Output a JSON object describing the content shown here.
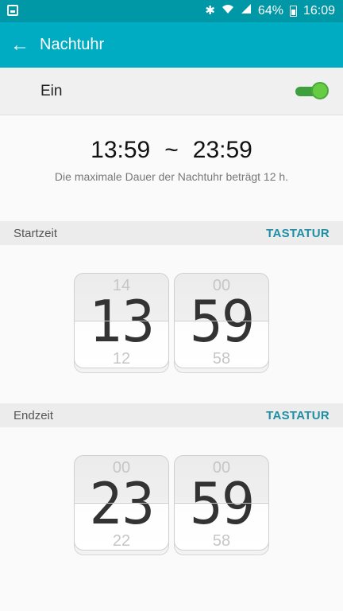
{
  "statusbar": {
    "battery_percent": "64%",
    "time": "16:09",
    "icons": [
      "image-notification-icon",
      "bluetooth-icon",
      "wifi-icon",
      "signal-icon",
      "battery-icon"
    ]
  },
  "appbar": {
    "title": "Nachtuhr",
    "back_icon": "arrow-left-icon",
    "back_glyph": "←"
  },
  "toggle": {
    "label": "Ein",
    "state": "on"
  },
  "range": {
    "start": "13:59",
    "separator": "~",
    "end": "23:59",
    "note": "Die maximale Dauer der Nachtuhr beträgt 12 h."
  },
  "start_section": {
    "label": "Startzeit",
    "action": "TASTATUR",
    "hour": {
      "prev": "14",
      "current": "13",
      "next": "12"
    },
    "minute": {
      "prev": "00",
      "current": "59",
      "next": "58"
    }
  },
  "end_section": {
    "label": "Endzeit",
    "action": "TASTATUR",
    "hour": {
      "prev": "00",
      "current": "23",
      "next": "22"
    },
    "minute": {
      "prev": "00",
      "current": "59",
      "next": "58"
    }
  },
  "colors": {
    "statusbar": "#0097a7",
    "appbar": "#00acc1",
    "accent": "#1e8fa5",
    "toggle_on": "#66cc44"
  }
}
